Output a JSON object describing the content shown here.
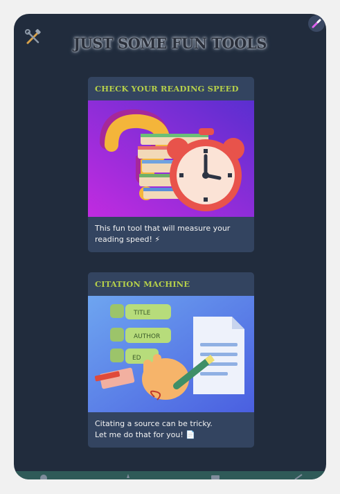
{
  "header": {
    "title": "JUST SOME FUN TOOLS",
    "logo_icon": "tools-icon",
    "theme_icon": "magic-wand-icon"
  },
  "cards": [
    {
      "title": "CHECK YOUR READING SPEED",
      "image_icon": "books-alarm-clock-illustration",
      "description": "This fun tool that will measure your reading speed! ⚡"
    },
    {
      "title": "CITATION MACHINE",
      "image_icon": "citation-illustration",
      "image_labels": [
        "TITLE",
        "AUTHOR",
        "ED"
      ],
      "description": "Citating a source can be tricky.\nLet me do that for you! 📄"
    }
  ],
  "bottom_nav": {
    "items": [
      "location-icon",
      "star-icon",
      "note-icon",
      "tools-icon"
    ]
  },
  "colors": {
    "background": "#212c3d",
    "card": "#334460",
    "card_title": "#b5cf4a",
    "nav": "#2f5a58"
  }
}
